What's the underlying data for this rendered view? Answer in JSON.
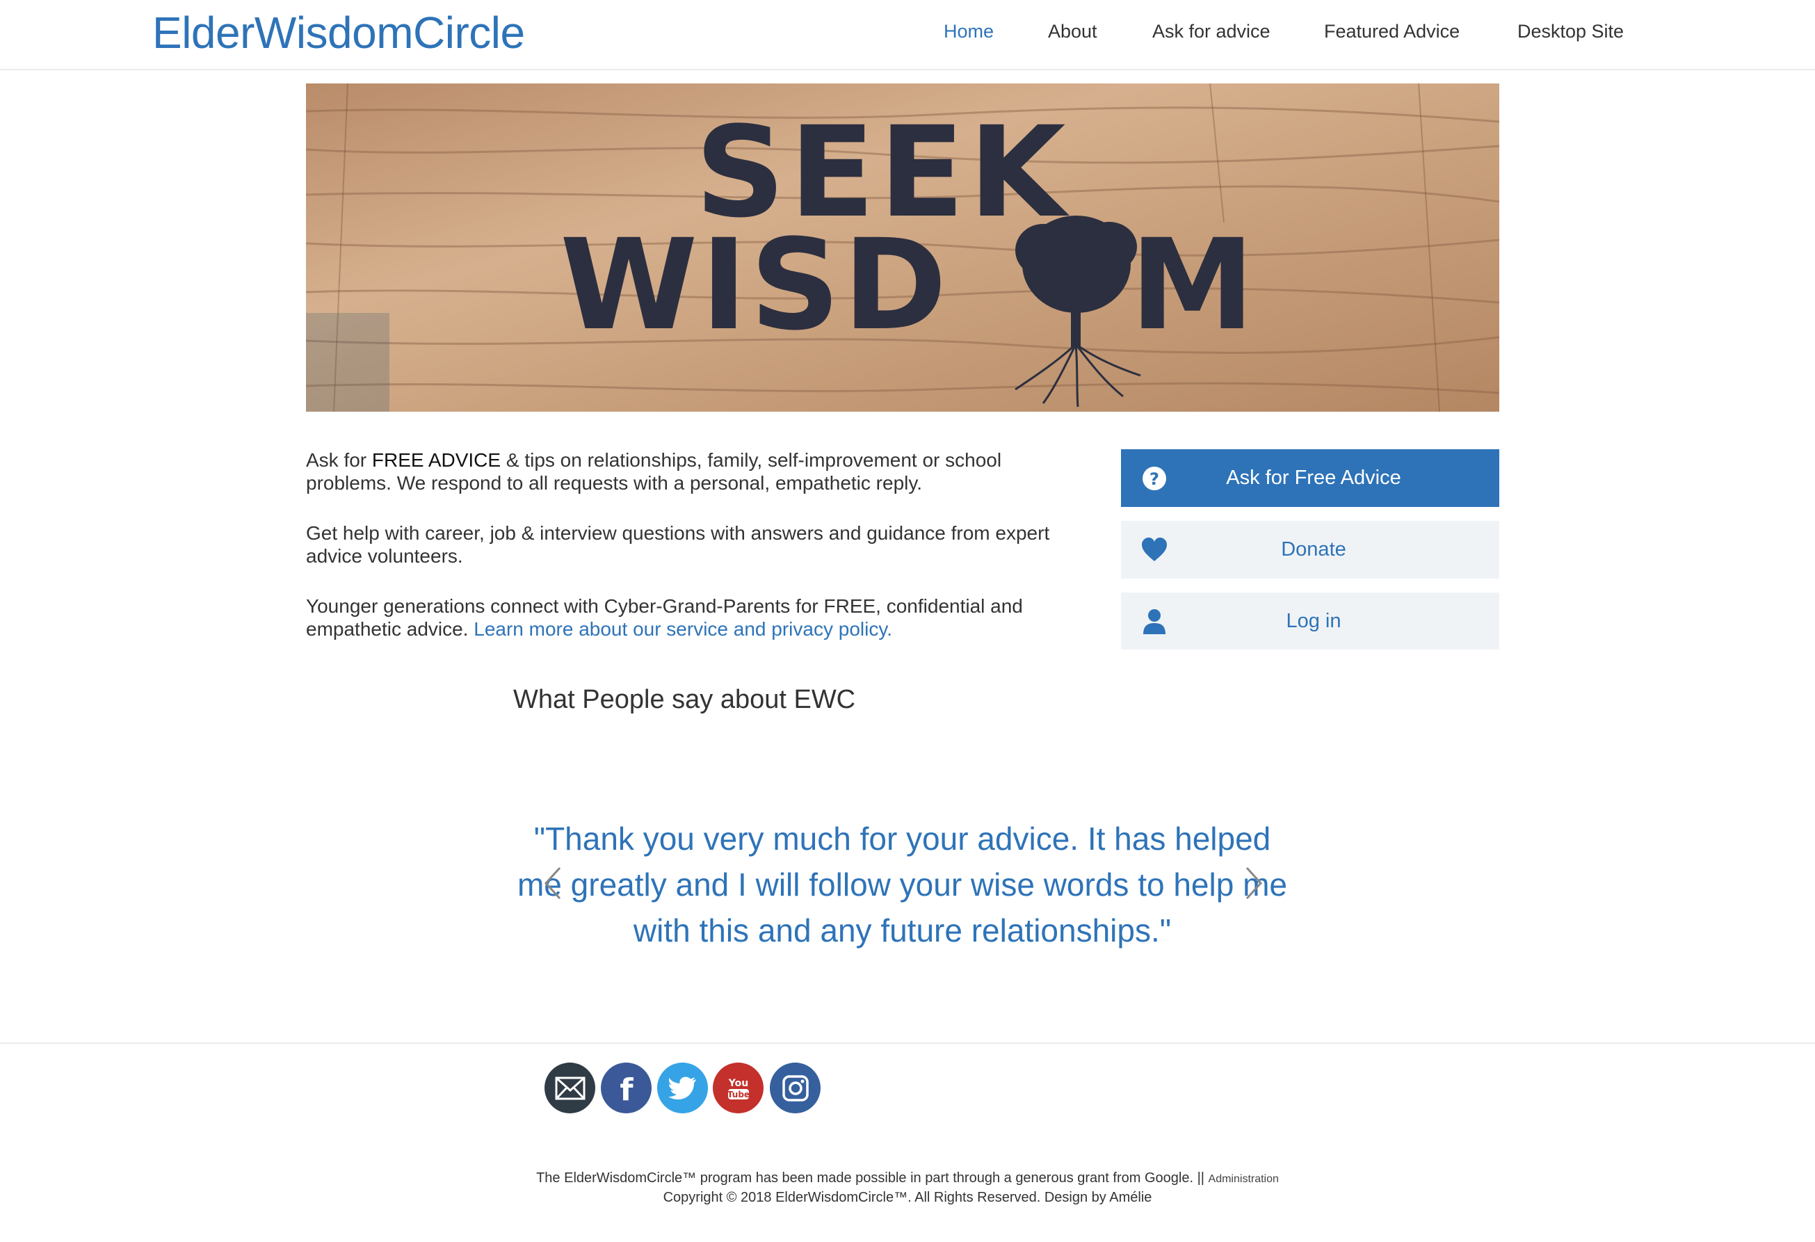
{
  "header": {
    "logo": "ElderWisdomCircle",
    "nav": [
      {
        "label": "Home",
        "active": true
      },
      {
        "label": "About",
        "active": false
      },
      {
        "label": "Ask for advice",
        "active": false
      },
      {
        "label": "Featured Advice",
        "active": false
      },
      {
        "label": "Desktop Site",
        "active": false
      }
    ]
  },
  "hero": {
    "line1": "SEEK",
    "line2_left": "WISD",
    "line2_right": "M"
  },
  "intro": {
    "p1_prefix": "Ask for ",
    "p1_strong": "FREE ADVICE",
    "p1_suffix": " & tips on relationships, family, self-improvement or school problems. We respond to all requests with a personal, empathetic reply.",
    "p2": "Get help with career, job & interview questions with answers and guidance from expert advice volunteers.",
    "p3_text": "Younger generations connect with Cyber-Grand-Parents for FREE, confidential and empathetic advice. ",
    "p3_link": "Learn more about our service and privacy policy."
  },
  "sidebar": {
    "ask": {
      "label": "Ask for Free Advice",
      "icon": "question-circle-icon"
    },
    "donate": {
      "label": "Donate",
      "icon": "heart-icon"
    },
    "login": {
      "label": "Log in",
      "icon": "user-icon"
    }
  },
  "testimonials": {
    "heading": "What People say about EWC",
    "quote": "\"Thank you very much for your advice. It has helped me greatly and I will follow your wise words to help me with this and any future relationships.\""
  },
  "social": [
    {
      "name": "email",
      "icon": "envelope-icon",
      "color": "#2f3b45"
    },
    {
      "name": "facebook",
      "icon": "facebook-icon",
      "color": "#3b5998"
    },
    {
      "name": "twitter",
      "icon": "twitter-icon",
      "color": "#35a3e5"
    },
    {
      "name": "youtube",
      "icon": "youtube-icon",
      "color": "#c4302b"
    },
    {
      "name": "instagram",
      "icon": "instagram-icon",
      "color": "#36609d"
    }
  ],
  "footer": {
    "line1": "The ElderWisdomCircle™ program has been made possible in part through a generous grant from Google. || ",
    "admin_link": "Administration",
    "line2": "Copyright © 2018 ElderWisdomCircle™. All Rights Reserved. Design by Amélie"
  },
  "colors": {
    "accent": "#2e73b8",
    "light_button": "#f0f3f6"
  }
}
